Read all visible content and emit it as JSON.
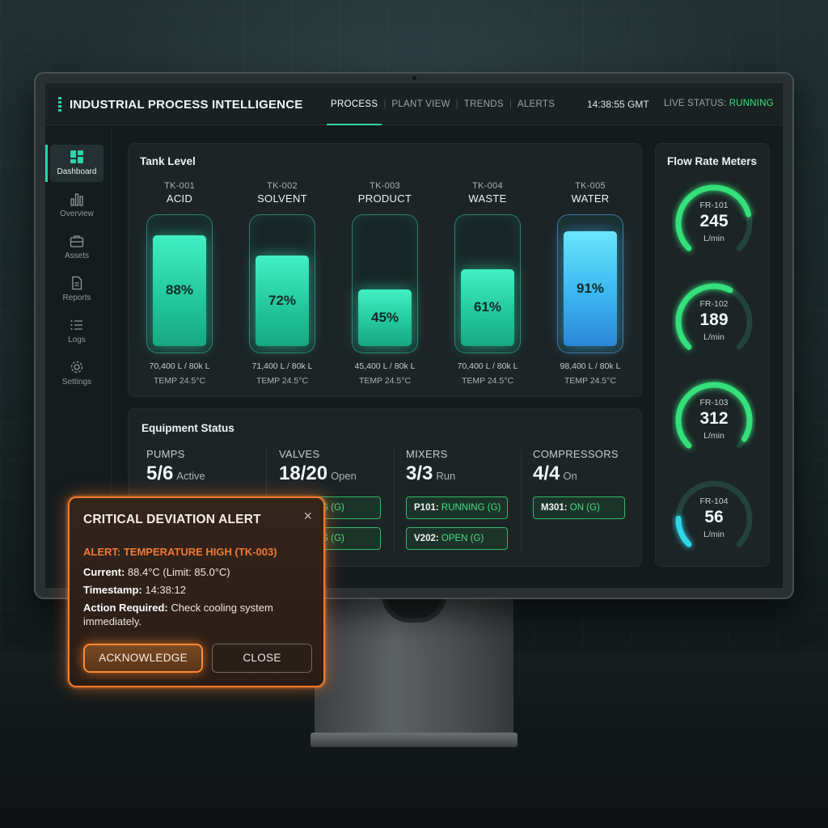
{
  "app": {
    "title": "INDUSTRIAL PROCESS INTELLIGENCE",
    "clock": "14:38:55 GMT",
    "live_label": "LIVE STATUS: ",
    "live_value": "RUNNING"
  },
  "nav": [
    {
      "label": "PROCESS",
      "active": true
    },
    {
      "label": "PLANT VIEW",
      "active": false
    },
    {
      "label": "TRENDS",
      "active": false
    },
    {
      "label": "ALERTS",
      "active": false
    }
  ],
  "sidebar": [
    {
      "label": "Dashboard",
      "icon": "grid-icon",
      "active": true
    },
    {
      "label": "Overview",
      "icon": "bar-chart-icon",
      "active": false
    },
    {
      "label": "Assets",
      "icon": "briefcase-icon",
      "active": false
    },
    {
      "label": "Reports",
      "icon": "document-icon",
      "active": false
    },
    {
      "label": "Logs",
      "icon": "list-icon",
      "active": false
    },
    {
      "label": "Settings",
      "icon": "gear-icon",
      "active": false
    }
  ],
  "tanks": {
    "title": "Tank Level",
    "items": [
      {
        "id": "TK-001",
        "name": "ACID",
        "percent": "88%",
        "level": 0.88,
        "volume": "70,400 L / 80k L",
        "temp": "TEMP 24.5°C",
        "color": "green"
      },
      {
        "id": "TK-002",
        "name": "SOLVENT",
        "percent": "72%",
        "level": 0.72,
        "volume": "71,400 L / 80k L",
        "temp": "TEMP 24.5°C",
        "color": "green"
      },
      {
        "id": "TK-003",
        "name": "PRODUCT",
        "percent": "45%",
        "level": 0.45,
        "volume": "45,400 L / 80k L",
        "temp": "TEMP 24.5°C",
        "color": "green"
      },
      {
        "id": "TK-004",
        "name": "WASTE",
        "percent": "61%",
        "level": 0.61,
        "volume": "70,400 L / 80k L",
        "temp": "TEMP 24.5°C",
        "color": "green"
      },
      {
        "id": "TK-005",
        "name": "WATER",
        "percent": "91%",
        "level": 0.91,
        "volume": "98,400 L / 80k L",
        "temp": "TEMP 24.5°C",
        "color": "blue"
      }
    ]
  },
  "equipment": {
    "title": "Equipment Status",
    "groups": [
      {
        "label": "PUMPS",
        "count": "5/6",
        "suffix": "Active"
      },
      {
        "label": "VALVES",
        "count": "18/20",
        "suffix": "Open"
      },
      {
        "label": "MIXERS",
        "count": "3/3",
        "suffix": "Run"
      },
      {
        "label": "COMPRESSORS",
        "count": "4/4",
        "suffix": "On"
      }
    ],
    "chips": {
      "valve_1": {
        "id": "",
        "status": "NNING (G)"
      },
      "valve_2": {
        "id": "",
        "status": "NNING (G)"
      },
      "mixer_1": {
        "id": "P101: ",
        "status": "RUNNING (G)"
      },
      "mixer_2": {
        "id": "V202: ",
        "status": "OPEN (G)"
      },
      "comp_1": {
        "id": "M301: ",
        "status": "ON (G)"
      }
    }
  },
  "flow": {
    "title": "Flow Rate Meters",
    "meters": [
      {
        "id": "FR-101",
        "value": "245",
        "unit": "L/min",
        "fraction": 0.78,
        "color": "#34e07a"
      },
      {
        "id": "FR-102",
        "value": "189",
        "unit": "L/min",
        "fraction": 0.6,
        "color": "#34e07a"
      },
      {
        "id": "FR-103",
        "value": "312",
        "unit": "L/min",
        "fraction": 0.95,
        "color": "#34e07a"
      },
      {
        "id": "FR-104",
        "value": "56",
        "unit": "L/min",
        "fraction": 0.17,
        "color": "#2fd6e8"
      }
    ]
  },
  "alert": {
    "title": "CRITICAL DEVIATION ALERT",
    "headline": "ALERT: TEMPERATURE HIGH (TK-003)",
    "current_label": "Current:",
    "current_value": " 88.4°C (Limit: 85.0°C)",
    "timestamp_label": "Timestamp:",
    "timestamp_value": " 14:38:12",
    "action_label": "Action Required:",
    "action_value": " Check cooling system immediately.",
    "acknowledge": "ACKNOWLEDGE",
    "close": "CLOSE",
    "close_icon": "×"
  }
}
